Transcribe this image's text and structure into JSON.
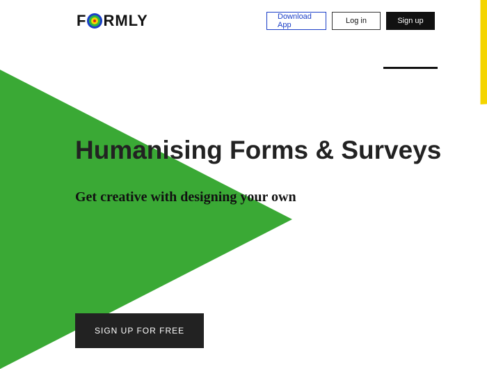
{
  "brand": {
    "name_pre": "F",
    "name_post": "RMLY"
  },
  "nav": {
    "download": "Download App",
    "login": "Log in",
    "signup": "Sign up"
  },
  "hero": {
    "headline": "Humanising Forms & Surveys",
    "subhead": "Get creative with designing your own",
    "cta": "SIGN UP FOR FREE"
  }
}
